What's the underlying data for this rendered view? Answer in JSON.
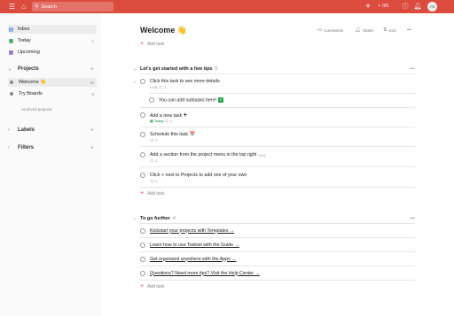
{
  "topbar": {
    "search_placeholder": "Search",
    "karma_count": "0/5",
    "avatar_initials": "AB"
  },
  "sidebar": {
    "items": [
      {
        "label": "Inbox",
        "count": ""
      },
      {
        "label": "Today",
        "count": "1"
      },
      {
        "label": "Upcoming",
        "count": ""
      }
    ],
    "projects_label": "Projects",
    "projects": [
      {
        "label": "Welcome 👋",
        "count": "16"
      },
      {
        "label": "Try Boards",
        "count": "9"
      }
    ],
    "archived_label": "Archived projects",
    "labels_label": "Labels",
    "filters_label": "Filters"
  },
  "header": {
    "title": "Welcome 👋",
    "comments_label": "Comments",
    "share_label": "Share",
    "sort_label": "Sort",
    "more_label": "•••"
  },
  "add_task_label": "Add task",
  "sections": [
    {
      "title": "Let's get started with a few tips",
      "count": "6",
      "more": "•••",
      "tasks": [
        {
          "title": "Click this task to see more details",
          "meta": "⤷ 0/1  🗨 1"
        },
        {
          "title": "You can add subtasks here!",
          "meta": ""
        },
        {
          "title": "Add a new task",
          "meta_today": "Today",
          "meta_comments": "🗨 1"
        },
        {
          "title": "Schedule this task 📅",
          "meta": "🗨 1"
        },
        {
          "title": "Add a section from the project menu in the top right",
          "code": "...",
          "meta": "🗨 1"
        },
        {
          "title": "Click + next to Projects to add one of your own",
          "meta": "🗨 1"
        }
      ]
    },
    {
      "title": "To go further",
      "count": "4",
      "more": "•••",
      "tasks": [
        {
          "title": "Kickstart your projects with Templates →"
        },
        {
          "title": "Learn how to use Todoist with the Guide →"
        },
        {
          "title": "Get organized anywhere with the Apps →"
        },
        {
          "title": "Questions? Need more tips? Visit the Help Center →"
        }
      ]
    }
  ],
  "colors": {
    "brand": "#db4c3f",
    "today_green": "#058527"
  }
}
